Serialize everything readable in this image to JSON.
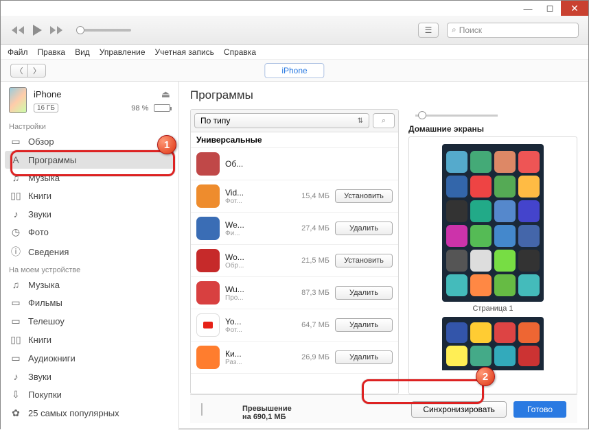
{
  "window": {
    "minimize": "—",
    "maximize": "◻",
    "close": "✕"
  },
  "toolbar": {
    "search_placeholder": "Поиск"
  },
  "menubar": [
    "Файл",
    "Правка",
    "Вид",
    "Управление",
    "Учетная запись",
    "Справка"
  ],
  "subbar": {
    "iphone_tab": "iPhone"
  },
  "device": {
    "name": "iPhone",
    "storage": "16 ГБ",
    "battery_pct": "98 %"
  },
  "sidebar": {
    "section1_label": "Настройки",
    "section1": [
      {
        "icon": "▭",
        "label": "Обзор"
      },
      {
        "icon": "A",
        "label": "Программы",
        "active": true
      },
      {
        "icon": "♫",
        "label": "Музыка"
      },
      {
        "icon": "▯▯",
        "label": "Книги"
      },
      {
        "icon": "♪",
        "label": "Звуки"
      },
      {
        "icon": "◷",
        "label": "Фото"
      },
      {
        "icon": "ⓘ",
        "label": "Сведения"
      }
    ],
    "section2_label": "На моем устройстве",
    "section2": [
      {
        "icon": "♫",
        "label": "Музыка"
      },
      {
        "icon": "▭",
        "label": "Фильмы"
      },
      {
        "icon": "▭",
        "label": "Телешоу"
      },
      {
        "icon": "▯▯",
        "label": "Книги"
      },
      {
        "icon": "▭",
        "label": "Аудиокниги"
      },
      {
        "icon": "♪",
        "label": "Звуки"
      },
      {
        "icon": "⇩",
        "label": "Покупки"
      },
      {
        "icon": "✿",
        "label": "25 самых популярных"
      }
    ]
  },
  "content": {
    "title": "Программы",
    "sort_label": "По типу",
    "list_header": "Универсальные",
    "apps": [
      {
        "name": "Об...",
        "meta": "",
        "size": "",
        "action": "",
        "color": "#c04848"
      },
      {
        "name": "Vid...",
        "meta": "Фот...",
        "size": "15,4 МБ",
        "action": "Установить",
        "color": "#ee8c2d"
      },
      {
        "name": "We...",
        "meta": "Фи...",
        "size": "27,4 МБ",
        "action": "Удалить",
        "color": "#3a6db5"
      },
      {
        "name": "Wo...",
        "meta": "Обр...",
        "size": "21,5 МБ",
        "action": "Установить",
        "color": "#c62a2a"
      },
      {
        "name": "Wu...",
        "meta": "Про...",
        "size": "87,3 МБ",
        "action": "Удалить",
        "color": "#d84040"
      },
      {
        "name": "Yo...",
        "meta": "Фот...",
        "size": "64,7 МБ",
        "action": "Удалить",
        "color": "#ffffff"
      },
      {
        "name": "Ки...",
        "meta": "Раз...",
        "size": "26,9 МБ",
        "action": "Удалить",
        "color": "#ff7d2e"
      }
    ],
    "screens_label": "Домашние экраны",
    "page1_label": "Страница 1",
    "screen1_colors": [
      "#5ac",
      "#4a7",
      "#d86",
      "#e55",
      "#36a",
      "#e44",
      "#5a5",
      "#fb4",
      "#333",
      "#2a8",
      "#58c",
      "#44c",
      "#c3a",
      "#5b5",
      "#48c",
      "#46a",
      "#555",
      "#ddd",
      "#7d4",
      "#333",
      "#4bb",
      "#f84",
      "#6b4",
      "#4bb"
    ],
    "screen2_colors": [
      "#35a",
      "#fc3",
      "#d44",
      "#e63",
      "#fe5",
      "#4a8",
      "#3ab",
      "#c33"
    ]
  },
  "footer": {
    "segments": [
      {
        "color": "#e86ea6",
        "w": 10
      },
      {
        "color": "#5a8ed4",
        "w": 8
      },
      {
        "color": "#36c4a0",
        "w": 40
      },
      {
        "color": "#6a5fd4",
        "w": 6
      },
      {
        "color": "#f0b800",
        "w": 8
      },
      {
        "color": "#a0a0a0",
        "w": 28
      }
    ],
    "overflow_text": "Превышение на 690,1 МБ",
    "sync_label": "Синхронизировать",
    "done_label": "Готово"
  },
  "callouts": {
    "c1": "1",
    "c2": "2"
  }
}
